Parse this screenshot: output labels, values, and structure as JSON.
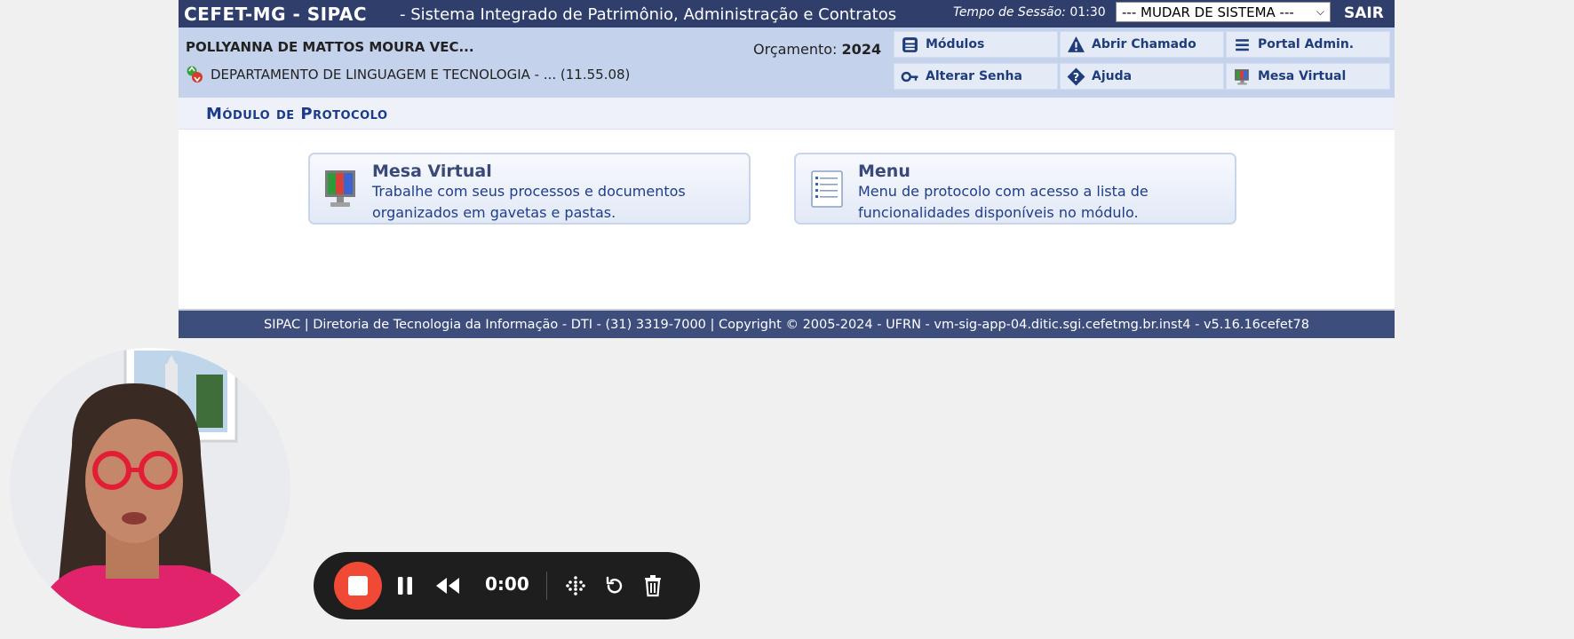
{
  "topbar": {
    "brand": "CEFET-MG - SIPAC",
    "subtitle": "- Sistema Integrado de Patrimônio, Administração e Contratos",
    "session_label": "Tempo de Sessão:",
    "session_time": "01:30",
    "system_select": "--- MUDAR DE SISTEMA ---",
    "logout": "SAIR"
  },
  "user": {
    "name": "POLLYANNA DE MATTOS MOURA VEC...",
    "department": "DEPARTAMENTO DE LINGUAGEM E TECNOLOGIA - ... (11.55.08)",
    "budget_label": "Orçamento:",
    "budget_year": "2024"
  },
  "quick_links": [
    {
      "label": "Módulos",
      "icon": "modules-icon"
    },
    {
      "label": "Abrir Chamado",
      "icon": "warning-icon"
    },
    {
      "label": "Portal Admin.",
      "icon": "list-icon"
    },
    {
      "label": "Alterar Senha",
      "icon": "key-icon"
    },
    {
      "label": "Ajuda",
      "icon": "help-icon"
    },
    {
      "label": "Mesa Virtual",
      "icon": "monitor-icon"
    }
  ],
  "module": {
    "title": "Módulo de Protocolo"
  },
  "cards": [
    {
      "title": "Mesa Virtual",
      "description": "Trabalhe com seus processos e documentos organizados em gavetas e pastas.",
      "icon": "monitor-icon"
    },
    {
      "title": "Menu",
      "description": "Menu de protocolo com acesso a lista de funcionalidades disponíveis no módulo.",
      "icon": "document-list-icon"
    }
  ],
  "footer": {
    "text": "SIPAC | Diretoria de Tecnologia da Informação - DTI - (31) 3319-7000 | Copyright © 2005-2024 - UFRN - vm-sig-app-04.ditic.sgi.cefetmg.br.inst4 - v5.16.16cefet78"
  },
  "recorder": {
    "timer": "0:00"
  },
  "colors": {
    "topbar": "#303e6c",
    "infobar": "#c4d2eb",
    "footer": "#3d4d7c",
    "stop_button": "#f04a37"
  }
}
